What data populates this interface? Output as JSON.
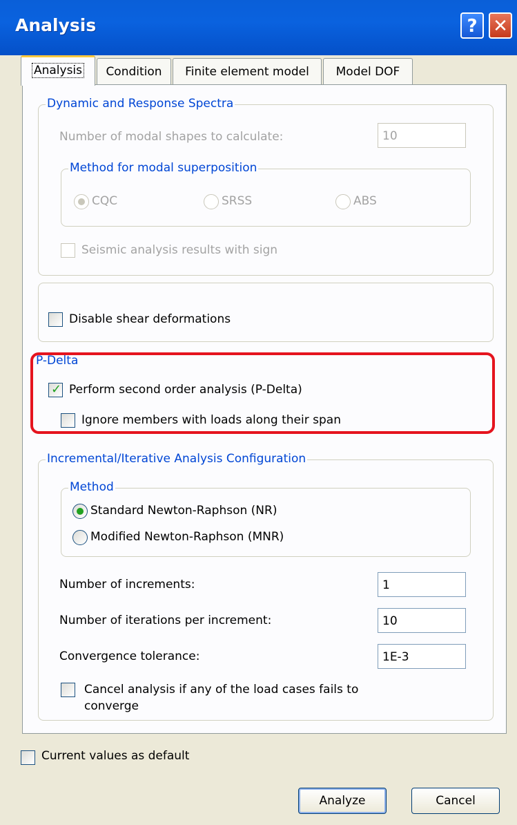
{
  "window": {
    "title": "Analysis",
    "help_label": "?",
    "close_label": "✕"
  },
  "tabs": [
    {
      "label": "Analysis",
      "active": true
    },
    {
      "label": "Condition",
      "active": false
    },
    {
      "label": "Finite element model",
      "active": false
    },
    {
      "label": "Model DOF",
      "active": false
    }
  ],
  "dynamic": {
    "legend": "Dynamic and Response Spectra",
    "modal_shapes_label": "Number of modal shapes to calculate:",
    "modal_shapes_value": "10",
    "superposition": {
      "legend": "Method for modal superposition",
      "options": [
        {
          "label": "CQC",
          "selected": true
        },
        {
          "label": "SRSS",
          "selected": false
        },
        {
          "label": "ABS",
          "selected": false
        }
      ]
    },
    "seismic_label": "Seismic analysis results with sign",
    "seismic_checked": false
  },
  "shear": {
    "label": "Disable shear deformations",
    "checked": false
  },
  "pdelta": {
    "legend": "P-Delta",
    "second_order_label": "Perform second order analysis (P-Delta)",
    "second_order_checked": true,
    "ignore_label": "Ignore members with loads along their span",
    "ignore_checked": false
  },
  "incremental": {
    "legend": "Incremental/Iterative Analysis Configuration",
    "method": {
      "legend": "Method",
      "options": [
        {
          "label": "Standard Newton-Raphson (NR)",
          "selected": true
        },
        {
          "label": "Modified Newton-Raphson (MNR)",
          "selected": false
        }
      ]
    },
    "increments_label": "Number of increments:",
    "increments_value": "1",
    "iterations_label": "Number of iterations per increment:",
    "iterations_value": "10",
    "tolerance_label": "Convergence tolerance:",
    "tolerance_value": "1E-3",
    "cancel_label_line1": "Cancel analysis if any of the load cases fails to",
    "cancel_label_line2": "converge",
    "cancel_checked": false
  },
  "defaults_label": "Current values as default",
  "defaults_checked": false,
  "buttons": {
    "analyze": "Analyze",
    "cancel": "Cancel"
  },
  "colors": {
    "titlebar": "#0a5fd8",
    "legend": "#0046d5",
    "highlight": "#e5141e",
    "check": "#21a121"
  }
}
